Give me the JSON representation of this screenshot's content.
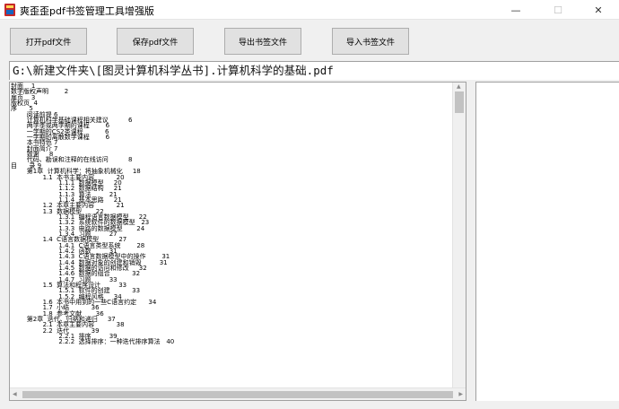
{
  "window": {
    "title": "爽歪歪pdf书签管理工具增强版",
    "controls": {
      "minimize": "—",
      "maximize": "☐",
      "close": "✕"
    }
  },
  "toolbar": {
    "open_label": "打开pdf文件",
    "save_label": "保存pdf文件",
    "export_label": "导出书签文件",
    "import_label": "导入书签文件"
  },
  "path": {
    "value": "G:\\新建文件夹\\[图灵计算机科学丛书].计算机科学的基础.pdf"
  },
  "bookmarks": {
    "lines": [
      "封面    1",
      "数字版权声明        2",
      "扉页    3",
      "版权页  4",
      "序      5",
      "        阅读前提 6",
      "        计算机科学基础课程相关建议          6",
      "        两学季或两学期的课程        6",
      "        一学期的CS2类课程           6",
      "        一学期的离散数学课程        6",
      "        本书特色 7",
      "        封面简介 7",
      "        致谢     8",
      "        代码、勘误和注释的在线访问          8",
      "目      录 9",
      "        第1章  计算机科学：将抽象机械化     18",
      "                1.1  本书主要内容           20",
      "                        1.1.1  数据模型     20",
      "                        1.1.2  数据结构     21",
      "                        1.1.3  算法         21",
      "                        1.1.4  基本思路     21",
      "                1.2  本章主要内容           21",
      "                1.3  数据模型       22",
      "                        1.3.1  编程语言数据模型     22",
      "                        1.3.2  系统软件的数据模型   23",
      "                        1.3.3  电路的数据模型       24",
      "                        1.3.4  习题         27",
      "                1.4  C语言数据模型          27",
      "                        1.4.1  C语言类型系统        28",
      "                        1.4.2  函数         31",
      "                        1.4.3  C语言数据模型中的操作        31",
      "                        1.4.4  数据对象的创建和销毁         31",
      "                        1.4.5  数据的访问和修改     32",
      "                        1.4.6  数据的组合           32",
      "                        1.4.7  习题         33",
      "                1.5  算法和程序设计         33",
      "                        1.5.1  软件的创建           33",
      "                        1.5.2  编程风格     34",
      "                1.6  本书中用到的一些C语言约定      34",
      "                1.7  小结           36",
      "                1.8  参考文献       36",
      "        第2章  迭代、归纳和递归     37",
      "                2.1  本章主要内容           38",
      "                2.2  迭代           39",
      "                        2.2.1  排序         39",
      "                        2.2.2  选择排序：一种迭代排序算法   40"
    ]
  }
}
